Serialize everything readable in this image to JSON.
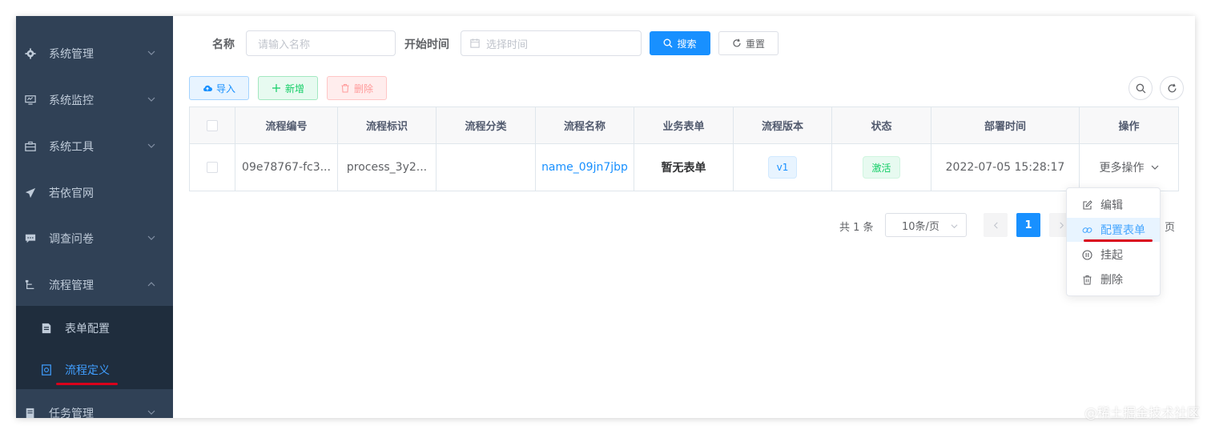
{
  "sidebar": {
    "items": [
      {
        "label": "系统管理",
        "icon": "gear-icon"
      },
      {
        "label": "系统监控",
        "icon": "monitor-icon"
      },
      {
        "label": "系统工具",
        "icon": "toolbox-icon"
      },
      {
        "label": "若依官网",
        "icon": "paper-plane-icon"
      },
      {
        "label": "调查问卷",
        "icon": "message-icon"
      },
      {
        "label": "流程管理",
        "icon": "flow-icon"
      },
      {
        "label": "任务管理",
        "icon": "task-icon"
      }
    ],
    "sub_items": [
      {
        "label": "表单配置",
        "icon": "form-icon"
      },
      {
        "label": "流程定义",
        "icon": "definition-icon",
        "active": true
      }
    ]
  },
  "search": {
    "name_label": "名称",
    "name_placeholder": "请输入名称",
    "time_label": "开始时间",
    "time_placeholder": "选择时间",
    "search_button": "搜索",
    "reset_button": "重置"
  },
  "toolbar": {
    "import_button": "导入",
    "add_button": "新增",
    "delete_button": "删除"
  },
  "table": {
    "columns": [
      "流程编号",
      "流程标识",
      "流程分类",
      "流程名称",
      "业务表单",
      "流程版本",
      "状态",
      "部署时间",
      "操作"
    ],
    "rows": [
      {
        "id": "09e78767-fc3...",
        "key": "process_3y2...",
        "category": "",
        "name": "name_09jn7jbp",
        "form": "暂无表单",
        "version": "v1",
        "status": "激活",
        "deploy_time": "2022-07-05 15:28:17",
        "action": "更多操作"
      }
    ]
  },
  "pagination": {
    "total": "共 1 条",
    "page_size": "10条/页",
    "current_page": "1",
    "suffix": "页"
  },
  "dropdown": {
    "items": [
      {
        "label": "编辑",
        "icon": "edit-icon"
      },
      {
        "label": "配置表单",
        "icon": "link-icon"
      },
      {
        "label": "挂起",
        "icon": "pause-icon"
      },
      {
        "label": "删除",
        "icon": "trash-icon"
      }
    ]
  },
  "watermark": "@稀土掘金技术社区",
  "colors": {
    "sidebar_bg": "#304156",
    "submenu_bg": "#1f2d3d",
    "primary": "#1890ff",
    "active_link": "#409eff",
    "success": "#13ce66",
    "danger_underline": "#d9001b"
  }
}
